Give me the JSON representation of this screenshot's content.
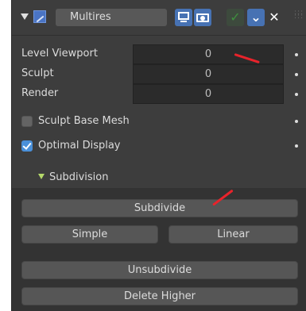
{
  "header": {
    "modifier_name": "Multires",
    "show_viewport_icon": "screen-icon",
    "show_render_icon": "camera-icon",
    "apply_glyph": "✓",
    "expand_glyph": "⌄",
    "remove_glyph": "✕"
  },
  "levels": [
    {
      "label": "Level Viewport",
      "value": "0"
    },
    {
      "label": "Sculpt",
      "value": "0"
    },
    {
      "label": "Render",
      "value": "0"
    }
  ],
  "options": {
    "sculpt_base_mesh": {
      "label": "Sculpt Base Mesh",
      "checked": false
    },
    "optimal_display": {
      "label": "Optimal Display",
      "checked": true
    }
  },
  "subdivision": {
    "title": "Subdivision",
    "subdivide": "Subdivide",
    "simple": "Simple",
    "linear": "Linear",
    "unsubdivide": "Unsubdivide",
    "delete_higher": "Delete Higher"
  },
  "colors": {
    "panel_bg": "#3d3d3d",
    "subpanel_bg": "#333333",
    "accent_blue": "#4772b3",
    "checkbox_blue": "#4a90d9",
    "annotation_red": "#e8232b"
  }
}
